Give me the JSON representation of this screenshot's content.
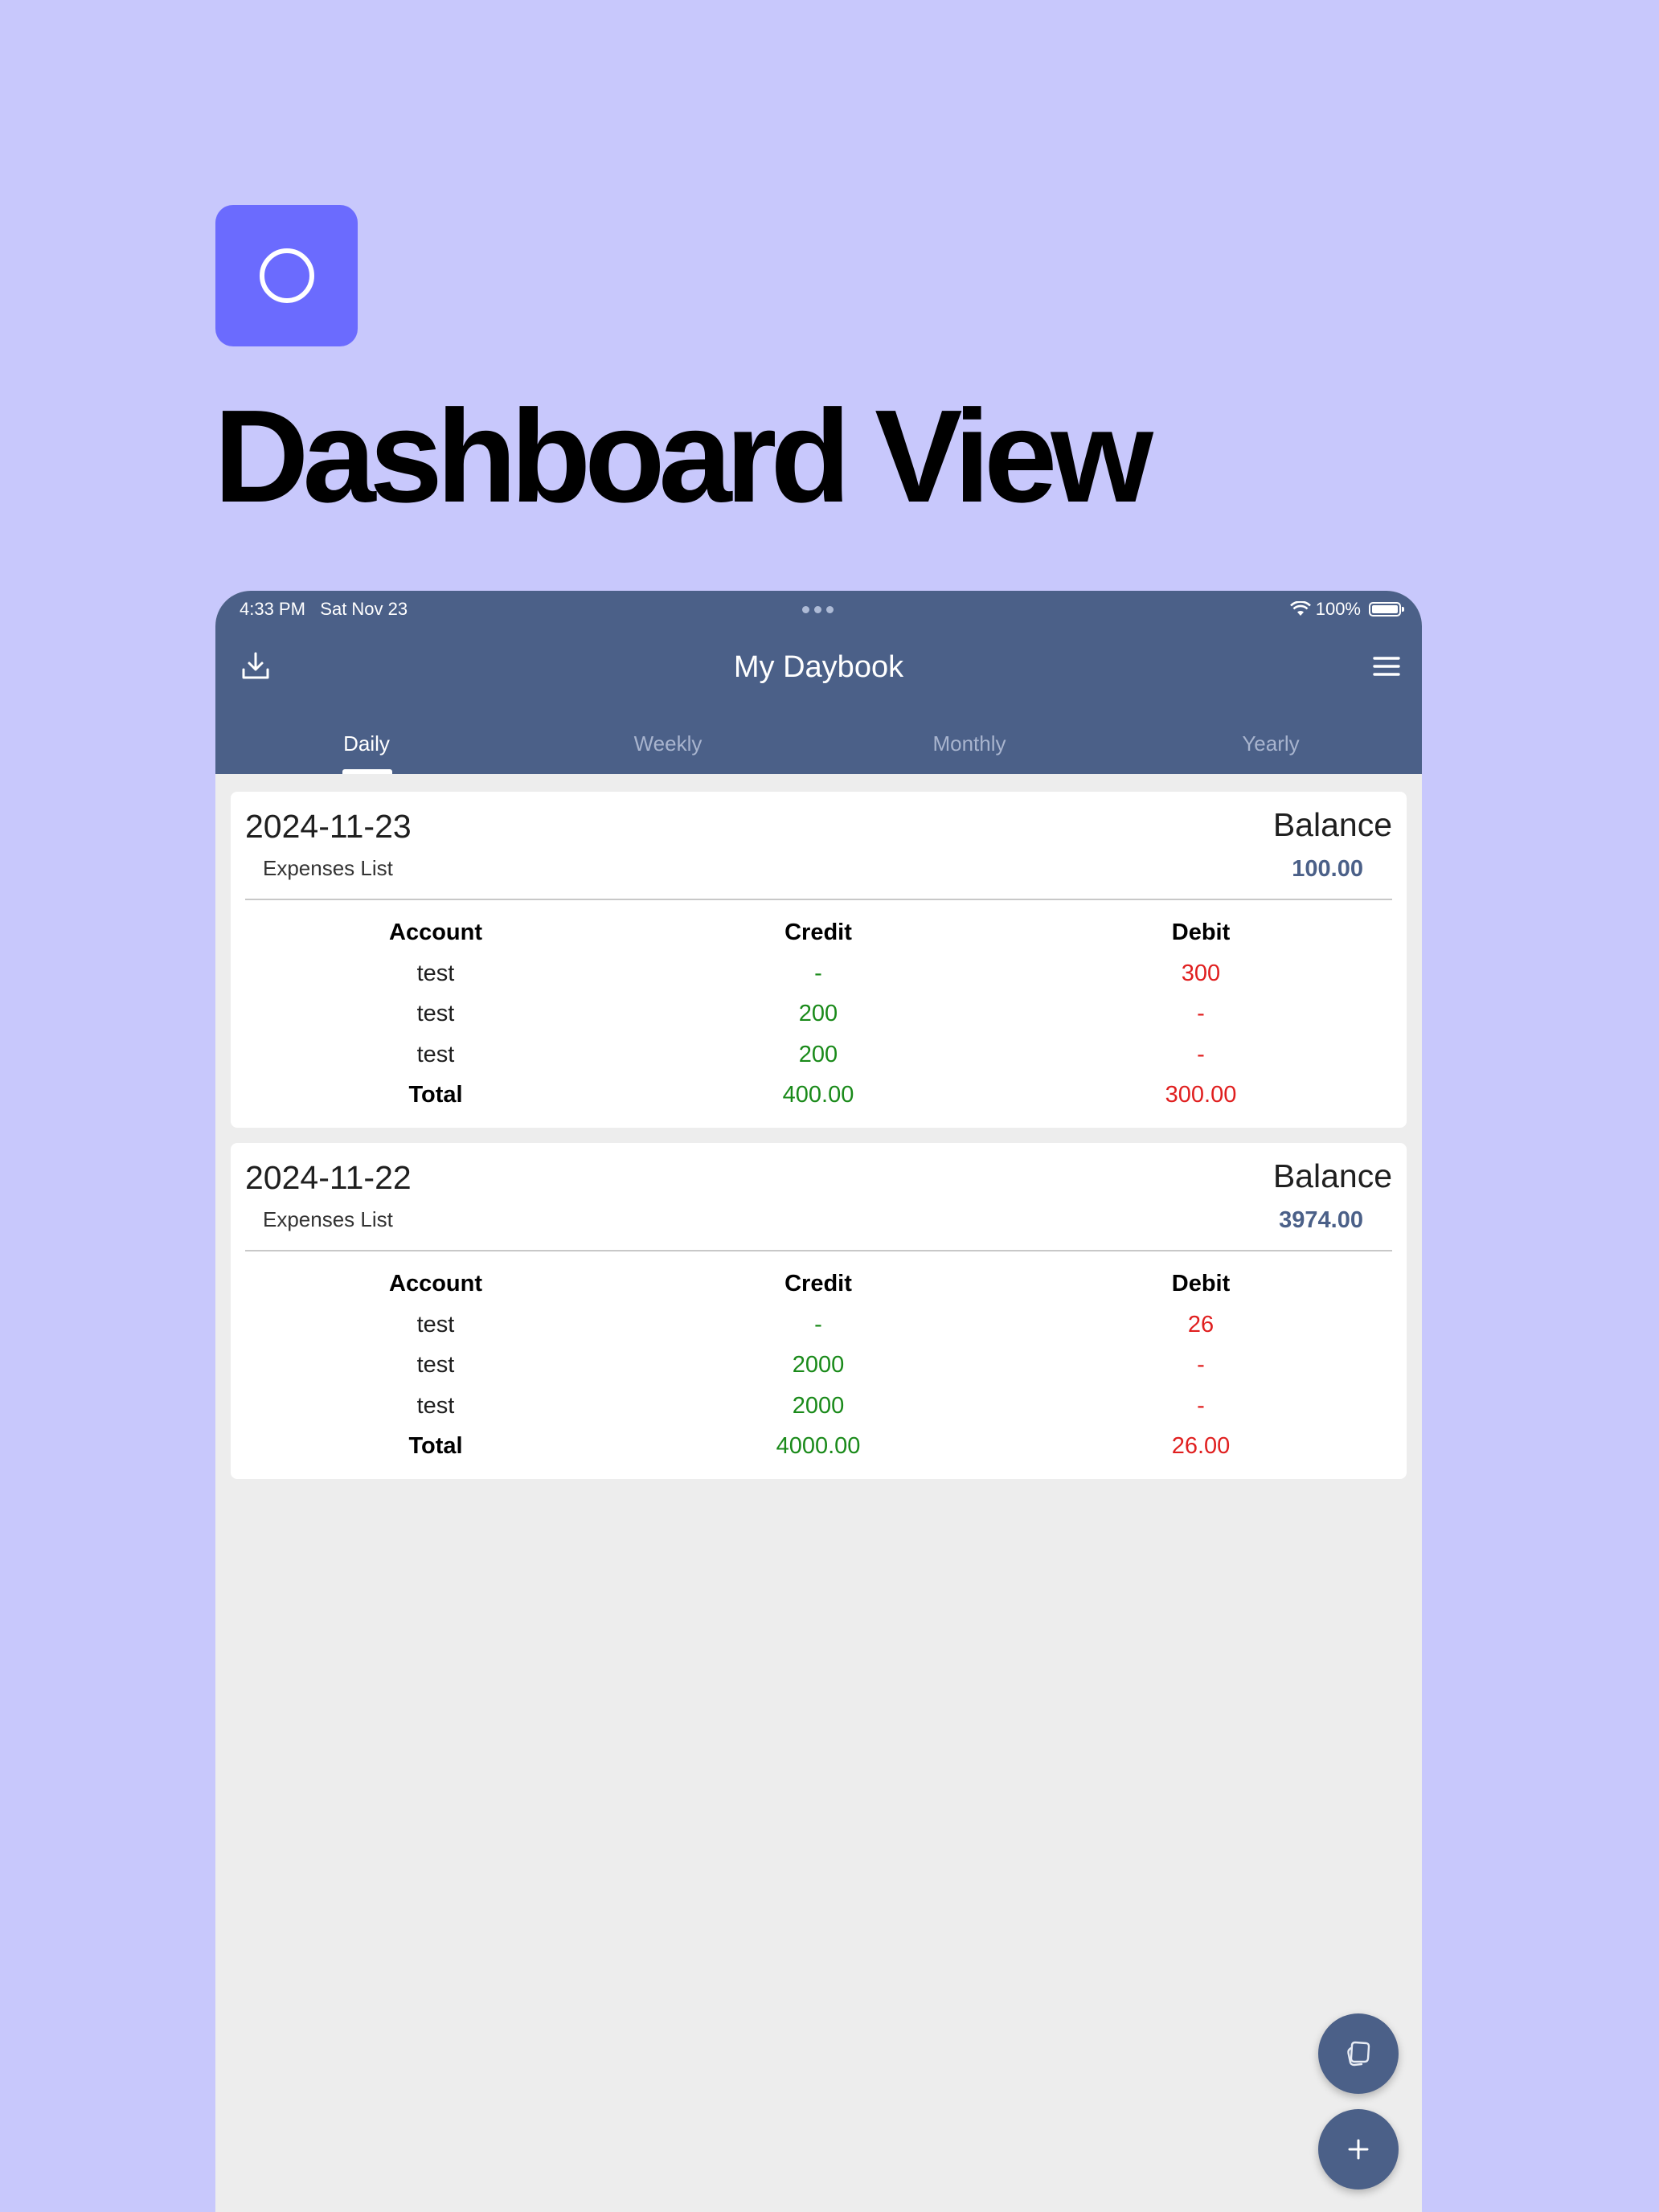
{
  "headline": "Dashboard View",
  "status_bar": {
    "time": "4:33 PM",
    "date": "Sat Nov 23",
    "battery": "100%"
  },
  "app_bar": {
    "title": "My Daybook"
  },
  "tabs": [
    {
      "label": "Daily",
      "active": true
    },
    {
      "label": "Weekly",
      "active": false
    },
    {
      "label": "Monthly",
      "active": false
    },
    {
      "label": "Yearly",
      "active": false
    }
  ],
  "table_headers": {
    "account": "Account",
    "credit": "Credit",
    "debit": "Debit"
  },
  "entries": [
    {
      "date": "2024-11-23",
      "balance_label": "Balance",
      "list_label": "Expenses List",
      "balance": "100.00",
      "rows": [
        {
          "account": "test",
          "credit": "-",
          "debit": "300"
        },
        {
          "account": "test",
          "credit": "200",
          "debit": "-"
        },
        {
          "account": "test",
          "credit": "200",
          "debit": "-"
        }
      ],
      "total": {
        "label": "Total",
        "credit": "400.00",
        "debit": "300.00"
      }
    },
    {
      "date": "2024-11-22",
      "balance_label": "Balance",
      "list_label": "Expenses List",
      "balance": "3974.00",
      "rows": [
        {
          "account": "test",
          "credit": "-",
          "debit": "26"
        },
        {
          "account": "test",
          "credit": "2000",
          "debit": "-"
        },
        {
          "account": "test",
          "credit": "2000",
          "debit": "-"
        }
      ],
      "total": {
        "label": "Total",
        "credit": "4000.00",
        "debit": "26.00"
      }
    }
  ],
  "icons": {
    "logo": "circle-logo-icon",
    "download": "download-icon",
    "menu": "hamburger-menu-icon",
    "fab_secondary": "cards-icon",
    "fab_primary": "plus-icon"
  },
  "colors": {
    "page_background": "#c8c8fc",
    "logo_tile": "#6b6bfe",
    "app_bar": "#4b6088",
    "credit": "#1a8a1a",
    "debit": "#e01f1f",
    "balance_value": "#4b6088"
  }
}
